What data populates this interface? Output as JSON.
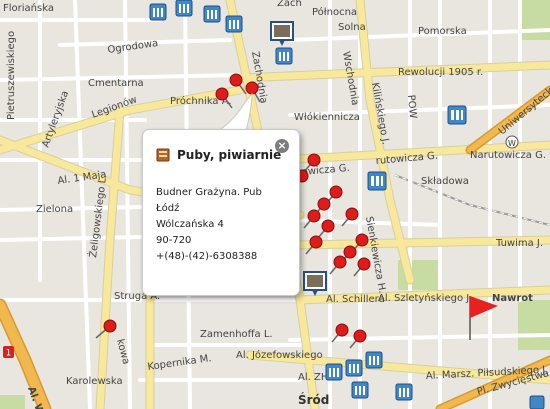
{
  "map": {
    "streets": {
      "florianska": "Floriańska",
      "zachodnia_top": "Zach",
      "polnocna": "Północna",
      "pomorska": "Pomorska",
      "ogrodowa": "Ogrodowa",
      "piotrkowskiego": "Pietruszewiskiego",
      "cmentarna": "Cmentarna",
      "zachodnia": "Zachodnia",
      "rewolucji": "Rewolucji 1905 r.",
      "legionow": "Legionów",
      "prochnika": "Próchnika A.",
      "wlokiennicza": "Włókiennicza",
      "kilinskiego": "Kilińskiego J.",
      "uniwersytecka": "Uniwersytecka",
      "artyleryjska": "Artyleryjska",
      "narutowicza_left": "owicza G.",
      "narutowicza_mid": "rutowicza G.",
      "narutowicza_right": "Narutowicza G.",
      "al1maja": "Al. 1 Maja",
      "zielona": "Zielona",
      "zeligowskiego": "Żeligowskiego L.",
      "wolczanska": "Wólczańska",
      "sienkiewicza": "Sienkiewicza H.",
      "skladowa": "Składowa",
      "tuwima": "Tuwima J.",
      "struga": "Struga A.",
      "schillera": "Al. Schillera",
      "szletynskiego": "Al. Szletyńskiego J.",
      "nawrot": "Nawrot",
      "zamenhoffa": "Zamenhoffa L.",
      "kopernika": "Kopernika M.",
      "karolewska": "Karolewska",
      "jozefowskiego": "Al. Józefowskiego",
      "marsz": "Al. Marsz. Piłsudskiego J.",
      "zwyciestwa": "Pl. Zwycięstwa",
      "zhp": "Al. ZHP",
      "kowa": "kowa",
      "al_w": "Al. W",
      "sroda": "Śród",
      "pow": "POW",
      "wschodnia": "Wschodnia",
      "solna": "Solna"
    },
    "route_shield": "1"
  },
  "popup": {
    "category": "Puby, piwiarnie",
    "name": "Budner Grażyna. Pub",
    "city": "Łódź",
    "street": "Wólczańska 4",
    "postcode": "90-720",
    "phone": "+(48)-(42)-6308388",
    "close_symbol": "×"
  },
  "colors": {
    "land": "#e9e6df",
    "block": "#f1efe8",
    "road": "#ffffff",
    "major_road": "#f7e89c",
    "motorway": "#f0b84e",
    "park": "#c6dca2",
    "pin": "#dd1c1c",
    "bldg_icon": "#3f87c9",
    "flag": "#e82020"
  }
}
